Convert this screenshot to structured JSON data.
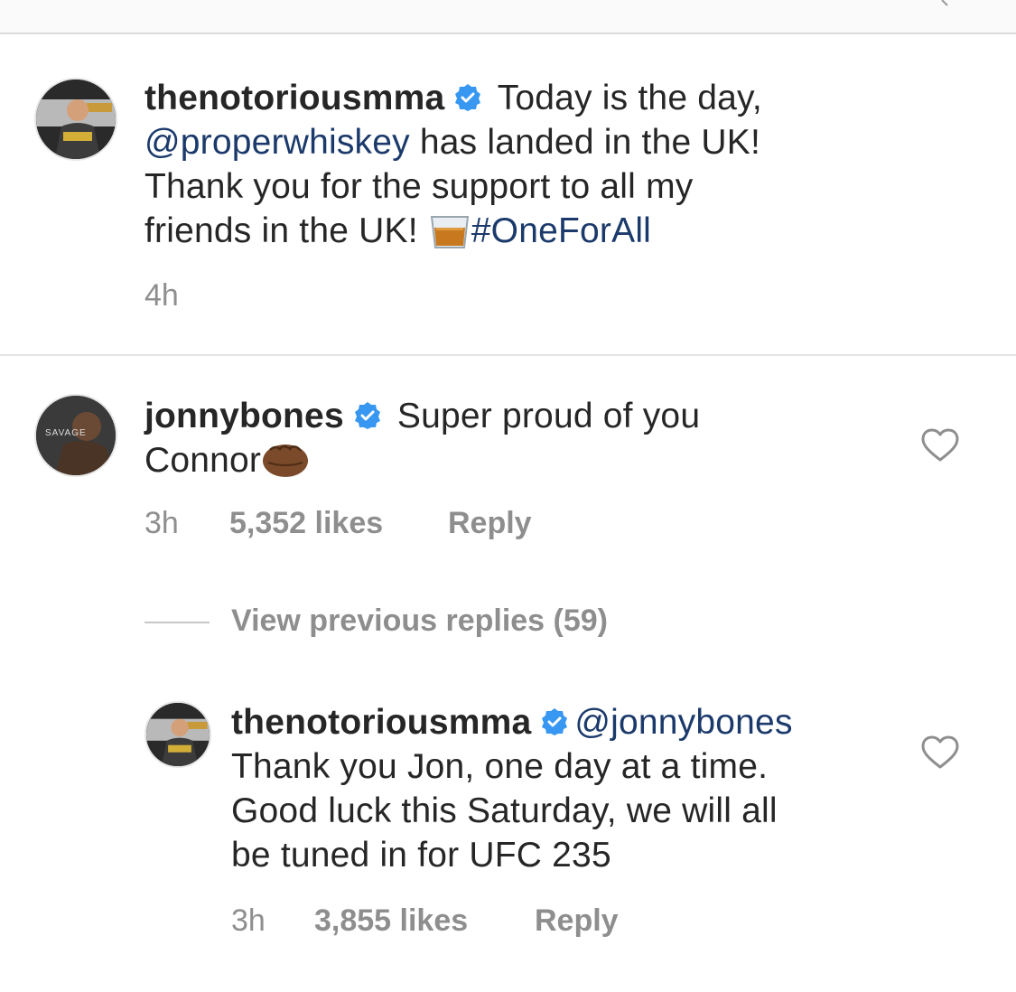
{
  "caption": {
    "username": "thenotoriousmma",
    "text_before": " Today is the day,",
    "mention": "@properwhiskey",
    "text_mid": " has landed in the UK!",
    "text_line3": "Thank you for the support to all my",
    "text_line4": "friends in the UK! ",
    "hashtag": "#OneForAll",
    "emoji_icon": "whiskey-glass-icon",
    "time": "4h"
  },
  "comment": {
    "username": "jonnybones",
    "text_line1": " Super proud of you",
    "text_line2": "Connor",
    "emoji_icon": "fist-bump-icon",
    "avatar_text": "SAVAGE",
    "time": "3h",
    "likes": "5,352 likes",
    "reply_label": "Reply"
  },
  "view_replies_label": "View previous replies (59)",
  "reply": {
    "username": "thenotoriousmma",
    "mention": "@jonnybones",
    "text_line2": "Thank you Jon, one day at a time.",
    "text_line3": "Good luck this Saturday, we will all",
    "text_line4": "be tuned in for UFC 235",
    "time": "3h",
    "likes": "3,855 likes",
    "reply_label": "Reply"
  },
  "colors": {
    "verified": "#3897f0",
    "link": "#1b3a6b",
    "meta": "#8e8e8e",
    "text": "#262626"
  }
}
